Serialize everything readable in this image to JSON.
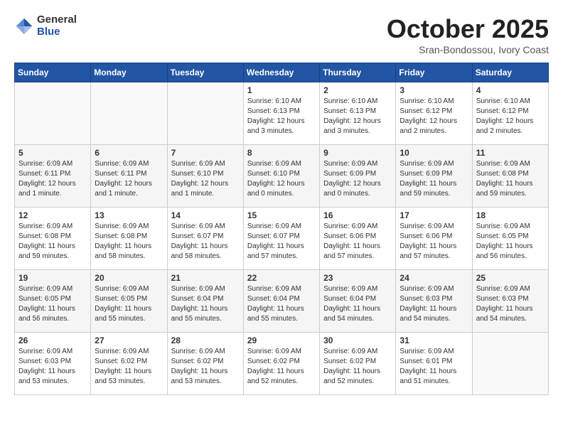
{
  "header": {
    "logo_general": "General",
    "logo_blue": "Blue",
    "month_title": "October 2025",
    "location": "Sran-Bondossou, Ivory Coast"
  },
  "days_of_week": [
    "Sunday",
    "Monday",
    "Tuesday",
    "Wednesday",
    "Thursday",
    "Friday",
    "Saturday"
  ],
  "weeks": [
    [
      {
        "day": "",
        "info": ""
      },
      {
        "day": "",
        "info": ""
      },
      {
        "day": "",
        "info": ""
      },
      {
        "day": "1",
        "info": "Sunrise: 6:10 AM\nSunset: 6:13 PM\nDaylight: 12 hours\nand 3 minutes."
      },
      {
        "day": "2",
        "info": "Sunrise: 6:10 AM\nSunset: 6:13 PM\nDaylight: 12 hours\nand 3 minutes."
      },
      {
        "day": "3",
        "info": "Sunrise: 6:10 AM\nSunset: 6:12 PM\nDaylight: 12 hours\nand 2 minutes."
      },
      {
        "day": "4",
        "info": "Sunrise: 6:10 AM\nSunset: 6:12 PM\nDaylight: 12 hours\nand 2 minutes."
      }
    ],
    [
      {
        "day": "5",
        "info": "Sunrise: 6:09 AM\nSunset: 6:11 PM\nDaylight: 12 hours\nand 1 minute."
      },
      {
        "day": "6",
        "info": "Sunrise: 6:09 AM\nSunset: 6:11 PM\nDaylight: 12 hours\nand 1 minute."
      },
      {
        "day": "7",
        "info": "Sunrise: 6:09 AM\nSunset: 6:10 PM\nDaylight: 12 hours\nand 1 minute."
      },
      {
        "day": "8",
        "info": "Sunrise: 6:09 AM\nSunset: 6:10 PM\nDaylight: 12 hours\nand 0 minutes."
      },
      {
        "day": "9",
        "info": "Sunrise: 6:09 AM\nSunset: 6:09 PM\nDaylight: 12 hours\nand 0 minutes."
      },
      {
        "day": "10",
        "info": "Sunrise: 6:09 AM\nSunset: 6:09 PM\nDaylight: 11 hours\nand 59 minutes."
      },
      {
        "day": "11",
        "info": "Sunrise: 6:09 AM\nSunset: 6:08 PM\nDaylight: 11 hours\nand 59 minutes."
      }
    ],
    [
      {
        "day": "12",
        "info": "Sunrise: 6:09 AM\nSunset: 6:08 PM\nDaylight: 11 hours\nand 59 minutes."
      },
      {
        "day": "13",
        "info": "Sunrise: 6:09 AM\nSunset: 6:08 PM\nDaylight: 11 hours\nand 58 minutes."
      },
      {
        "day": "14",
        "info": "Sunrise: 6:09 AM\nSunset: 6:07 PM\nDaylight: 11 hours\nand 58 minutes."
      },
      {
        "day": "15",
        "info": "Sunrise: 6:09 AM\nSunset: 6:07 PM\nDaylight: 11 hours\nand 57 minutes."
      },
      {
        "day": "16",
        "info": "Sunrise: 6:09 AM\nSunset: 6:06 PM\nDaylight: 11 hours\nand 57 minutes."
      },
      {
        "day": "17",
        "info": "Sunrise: 6:09 AM\nSunset: 6:06 PM\nDaylight: 11 hours\nand 57 minutes."
      },
      {
        "day": "18",
        "info": "Sunrise: 6:09 AM\nSunset: 6:05 PM\nDaylight: 11 hours\nand 56 minutes."
      }
    ],
    [
      {
        "day": "19",
        "info": "Sunrise: 6:09 AM\nSunset: 6:05 PM\nDaylight: 11 hours\nand 56 minutes."
      },
      {
        "day": "20",
        "info": "Sunrise: 6:09 AM\nSunset: 6:05 PM\nDaylight: 11 hours\nand 55 minutes."
      },
      {
        "day": "21",
        "info": "Sunrise: 6:09 AM\nSunset: 6:04 PM\nDaylight: 11 hours\nand 55 minutes."
      },
      {
        "day": "22",
        "info": "Sunrise: 6:09 AM\nSunset: 6:04 PM\nDaylight: 11 hours\nand 55 minutes."
      },
      {
        "day": "23",
        "info": "Sunrise: 6:09 AM\nSunset: 6:04 PM\nDaylight: 11 hours\nand 54 minutes."
      },
      {
        "day": "24",
        "info": "Sunrise: 6:09 AM\nSunset: 6:03 PM\nDaylight: 11 hours\nand 54 minutes."
      },
      {
        "day": "25",
        "info": "Sunrise: 6:09 AM\nSunset: 6:03 PM\nDaylight: 11 hours\nand 54 minutes."
      }
    ],
    [
      {
        "day": "26",
        "info": "Sunrise: 6:09 AM\nSunset: 6:03 PM\nDaylight: 11 hours\nand 53 minutes."
      },
      {
        "day": "27",
        "info": "Sunrise: 6:09 AM\nSunset: 6:02 PM\nDaylight: 11 hours\nand 53 minutes."
      },
      {
        "day": "28",
        "info": "Sunrise: 6:09 AM\nSunset: 6:02 PM\nDaylight: 11 hours\nand 53 minutes."
      },
      {
        "day": "29",
        "info": "Sunrise: 6:09 AM\nSunset: 6:02 PM\nDaylight: 11 hours\nand 52 minutes."
      },
      {
        "day": "30",
        "info": "Sunrise: 6:09 AM\nSunset: 6:02 PM\nDaylight: 11 hours\nand 52 minutes."
      },
      {
        "day": "31",
        "info": "Sunrise: 6:09 AM\nSunset: 6:01 PM\nDaylight: 11 hours\nand 51 minutes."
      },
      {
        "day": "",
        "info": ""
      }
    ]
  ]
}
